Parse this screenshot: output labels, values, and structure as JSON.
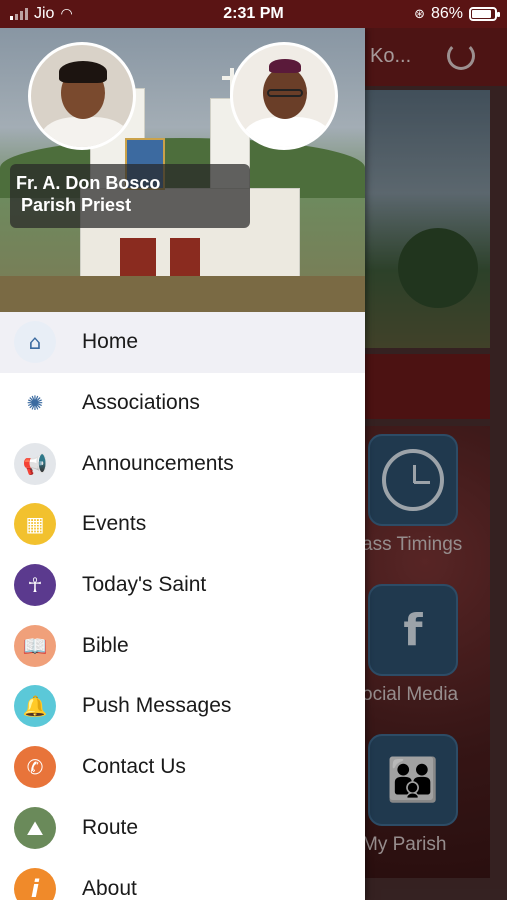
{
  "status_bar": {
    "carrier": "Jio",
    "time": "2:31 PM",
    "battery": "86%",
    "battery_level": 0.86
  },
  "background_app": {
    "title": "Ko...",
    "tiles": [
      {
        "label": "ass Timings",
        "icon": "clock-icon"
      },
      {
        "label": "ocial Media",
        "icon": "facebook-icon"
      },
      {
        "label": "My Parish",
        "icon": "family-icon"
      }
    ]
  },
  "drawer": {
    "priest_name": "Fr. A. Don Bosco",
    "priest_role": "Parish Priest",
    "menu": [
      {
        "label": "Home",
        "icon": "home-icon",
        "color": "#e8eef6",
        "glyph": "⌂",
        "active": true
      },
      {
        "label": "Associations",
        "icon": "associations-icon",
        "color": "#ffffff",
        "glyph": "✺"
      },
      {
        "label": "Announcements",
        "icon": "megaphone-icon",
        "color": "#e3e6ea",
        "glyph": "📢"
      },
      {
        "label": "Events",
        "icon": "calendar-icon",
        "color": "#f2c12e",
        "glyph": "▦"
      },
      {
        "label": "Today's Saint",
        "icon": "saint-icon",
        "color": "#5b3a8e",
        "glyph": "☥"
      },
      {
        "label": "Bible",
        "icon": "bible-icon",
        "color": "#f0a07a",
        "glyph": "📖"
      },
      {
        "label": "Push Messages",
        "icon": "bell-icon",
        "color": "#5bc8d8",
        "glyph": "🔔"
      },
      {
        "label": "Contact Us",
        "icon": "phone-icon",
        "color": "#e8743a",
        "glyph": "✆"
      },
      {
        "label": "Route",
        "icon": "route-icon",
        "color": "#6a8a5a",
        "glyph": "⛰"
      },
      {
        "label": "About",
        "icon": "info-icon",
        "color": "#f08a2a",
        "glyph": "i"
      }
    ]
  }
}
